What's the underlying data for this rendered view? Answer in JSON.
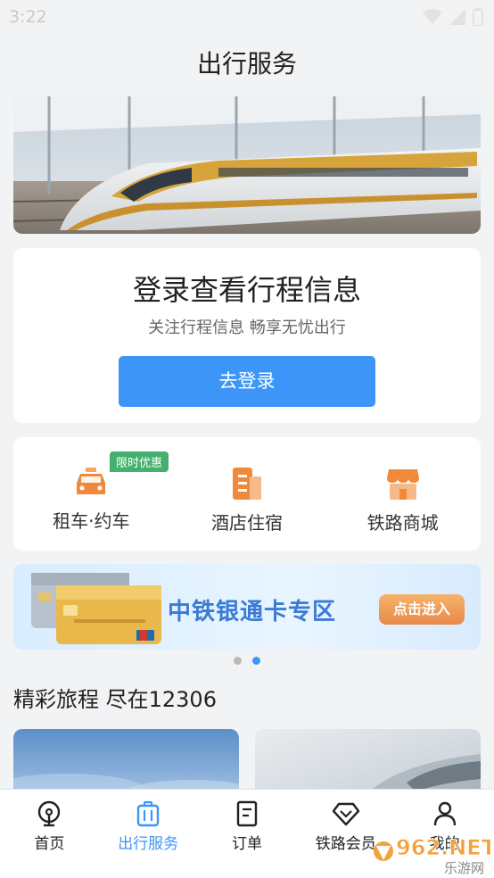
{
  "status_bar": {
    "time": "3:22"
  },
  "page": {
    "title": "出行服务"
  },
  "login_card": {
    "title": "登录查看行程信息",
    "subtitle": "关注行程信息  畅享无忧出行",
    "button": "去登录"
  },
  "services": [
    {
      "label": "租车·约车",
      "icon": "car-icon",
      "badge": "限时优惠"
    },
    {
      "label": "酒店住宿",
      "icon": "hotel-icon"
    },
    {
      "label": "铁路商城",
      "icon": "shop-icon"
    }
  ],
  "ad_banner": {
    "title": "中铁银通卡专区",
    "button": "点击进入"
  },
  "carousel": {
    "count": 2,
    "active": 2
  },
  "section": {
    "title": "精彩旅程 尽在12306"
  },
  "tabs": [
    {
      "label": "首页",
      "icon": "train-home-icon",
      "active": false
    },
    {
      "label": "出行服务",
      "icon": "luggage-icon",
      "active": true
    },
    {
      "label": "订单",
      "icon": "order-list-icon",
      "active": false
    },
    {
      "label": "铁路会员",
      "icon": "diamond-icon",
      "active": false
    },
    {
      "label": "我的",
      "icon": "person-icon",
      "active": false
    }
  ],
  "watermark": {
    "text": "962.NET",
    "sub": "乐游网"
  },
  "colors": {
    "accent": "#3d95f7",
    "badge": "#45b06d",
    "icon_orange": "#f08a3a"
  }
}
